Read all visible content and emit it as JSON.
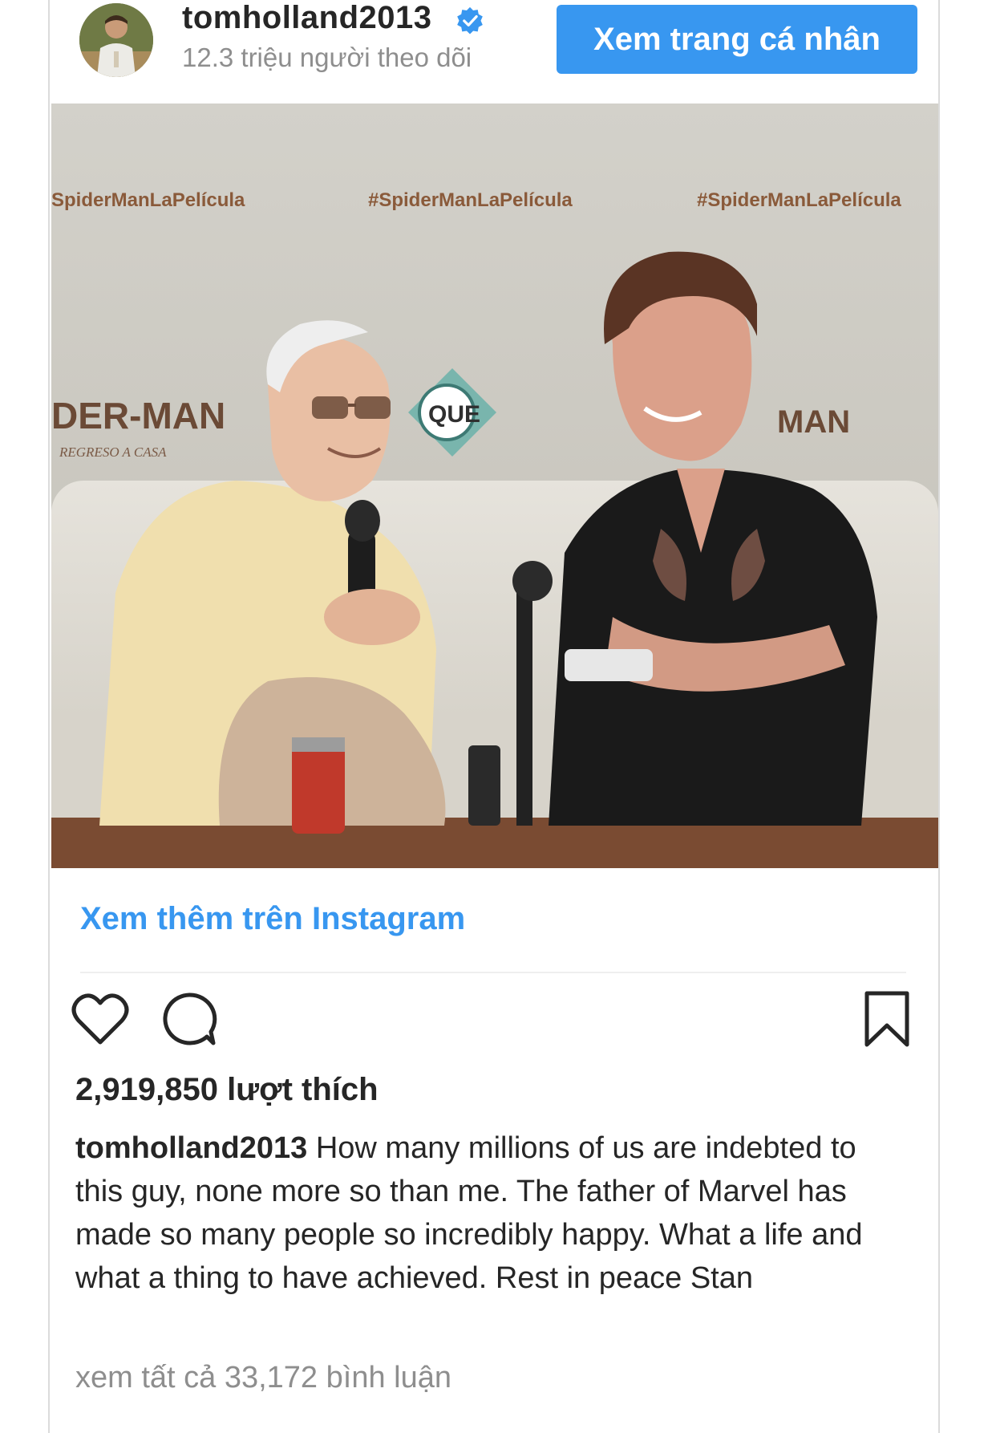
{
  "post": {
    "username": "tomholland2013",
    "followers": "12.3 triệu người theo dõi",
    "profile_button": "Xem trang cá nhân",
    "photo_texts": {
      "hashtag_left": "SpiderManLaPelícula",
      "hashtag_center": "#SpiderManLaPelícula",
      "hashtag_right": "#SpiderManLaPelícula",
      "banner_left": "DER-MAN",
      "banner_left_sub": "REGRESO A CASA",
      "banner_right": "MAN",
      "logo_center": "QUE"
    },
    "more_link": "Xem thêm trên Instagram",
    "likes": "2,919,850 lượt thích",
    "caption_user": "tomholland2013",
    "caption_text": "How many millions of us are indebted to this guy, none more so than me. The father of Marvel has made so many people so incredibly happy. What a life and what a thing to have achieved. Rest in peace Stan",
    "comments_link": "xem tất cả 33,172 bình luận"
  },
  "colors": {
    "accent": "#3897f0",
    "muted": "#8e8e8e",
    "text": "#262626"
  },
  "icons": {
    "verified": "verified-badge-icon",
    "like": "heart-icon",
    "comment": "comment-bubble-icon",
    "save": "bookmark-icon"
  }
}
